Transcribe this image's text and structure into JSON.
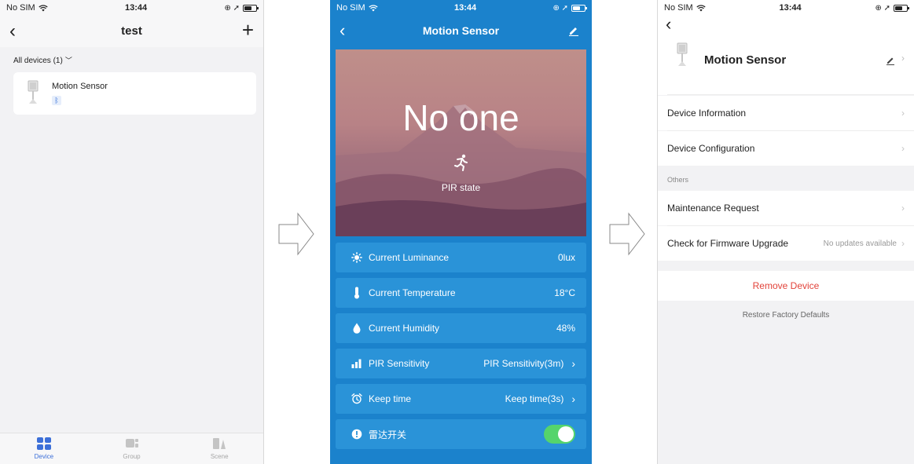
{
  "status": {
    "carrier": "No SIM",
    "time": "13:44"
  },
  "screen1": {
    "title": "test",
    "filter_label": "All devices (1)",
    "device": {
      "name": "Motion Sensor"
    },
    "tabs": [
      {
        "label": "Device",
        "active": true
      },
      {
        "label": "Group",
        "active": false
      },
      {
        "label": "Scene",
        "active": false
      }
    ]
  },
  "screen2": {
    "title": "Motion Sensor",
    "state": "No one",
    "state_caption": "PIR state",
    "rows": [
      {
        "icon": "sun-icon",
        "label": "Current Luminance",
        "value": "0lux"
      },
      {
        "icon": "thermometer-icon",
        "label": "Current Temperature",
        "value": "18°C"
      },
      {
        "icon": "droplet-icon",
        "label": "Current Humidity",
        "value": "48%"
      },
      {
        "icon": "signal-bars-icon",
        "label": "PIR Sensitivity",
        "value": "PIR Sensitivity(3m)"
      },
      {
        "icon": "alarm-clock-icon",
        "label": "Keep time",
        "value": "Keep time(3s)"
      },
      {
        "icon": "info-icon",
        "label": "雷达开关",
        "toggle_on": true
      }
    ],
    "colors": {
      "background": "#1b82cc",
      "row": "#2a93d8",
      "toggle": "#55d46c"
    }
  },
  "screen3": {
    "device_name": "Motion Sensor",
    "items": [
      {
        "label": "Device Information"
      },
      {
        "label": "Device Configuration"
      }
    ],
    "section_label": "Others",
    "other_items": [
      {
        "label": "Maintenance Request",
        "value": ""
      },
      {
        "label": "Check for Firmware Upgrade",
        "value": "No updates available"
      }
    ],
    "remove_label": "Remove Device",
    "restore_label": "Restore Factory Defaults",
    "colors": {
      "danger": "#e2433a"
    }
  }
}
